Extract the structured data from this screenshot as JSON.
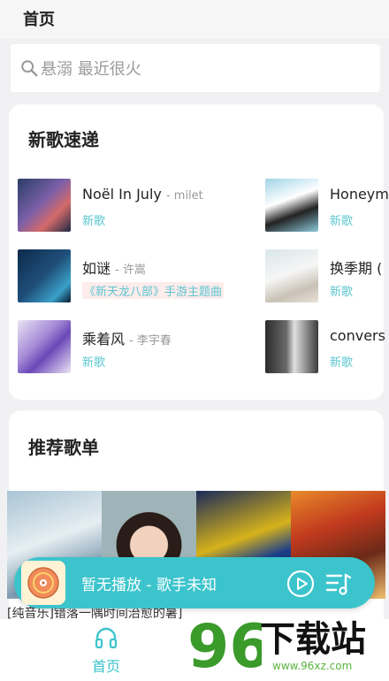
{
  "header": {
    "title": "首页"
  },
  "search": {
    "placeholder": "悬溺 最近很火"
  },
  "new_songs": {
    "title": "新歌速递",
    "items": [
      {
        "title": "Noël In July",
        "artist": "- milet",
        "tag": "新歌"
      },
      {
        "title": "Honeym",
        "artist": "",
        "tag": "新歌"
      },
      {
        "title": "如谜",
        "artist": "- 许嵩",
        "tag": "《新天龙八部》手游主题曲"
      },
      {
        "title": "换季期 (",
        "artist": "",
        "tag": "新歌"
      },
      {
        "title": "乘着风",
        "artist": "- 李宇春",
        "tag": "新歌"
      },
      {
        "title": "convers",
        "artist": "",
        "tag": "新歌"
      }
    ]
  },
  "recommend": {
    "title": "推荐歌单",
    "first_caption": "[纯音乐]错落一隅时间治愈的暑]"
  },
  "player": {
    "now_playing": "暂无播放 - 歌手未知"
  },
  "nav": {
    "home_label": "首页"
  },
  "watermark": {
    "text": "下载站",
    "url": "www.96xz.com",
    "number": "96"
  },
  "colors": {
    "accent": "#3cc4cc",
    "tag": "#5bc6cf"
  }
}
